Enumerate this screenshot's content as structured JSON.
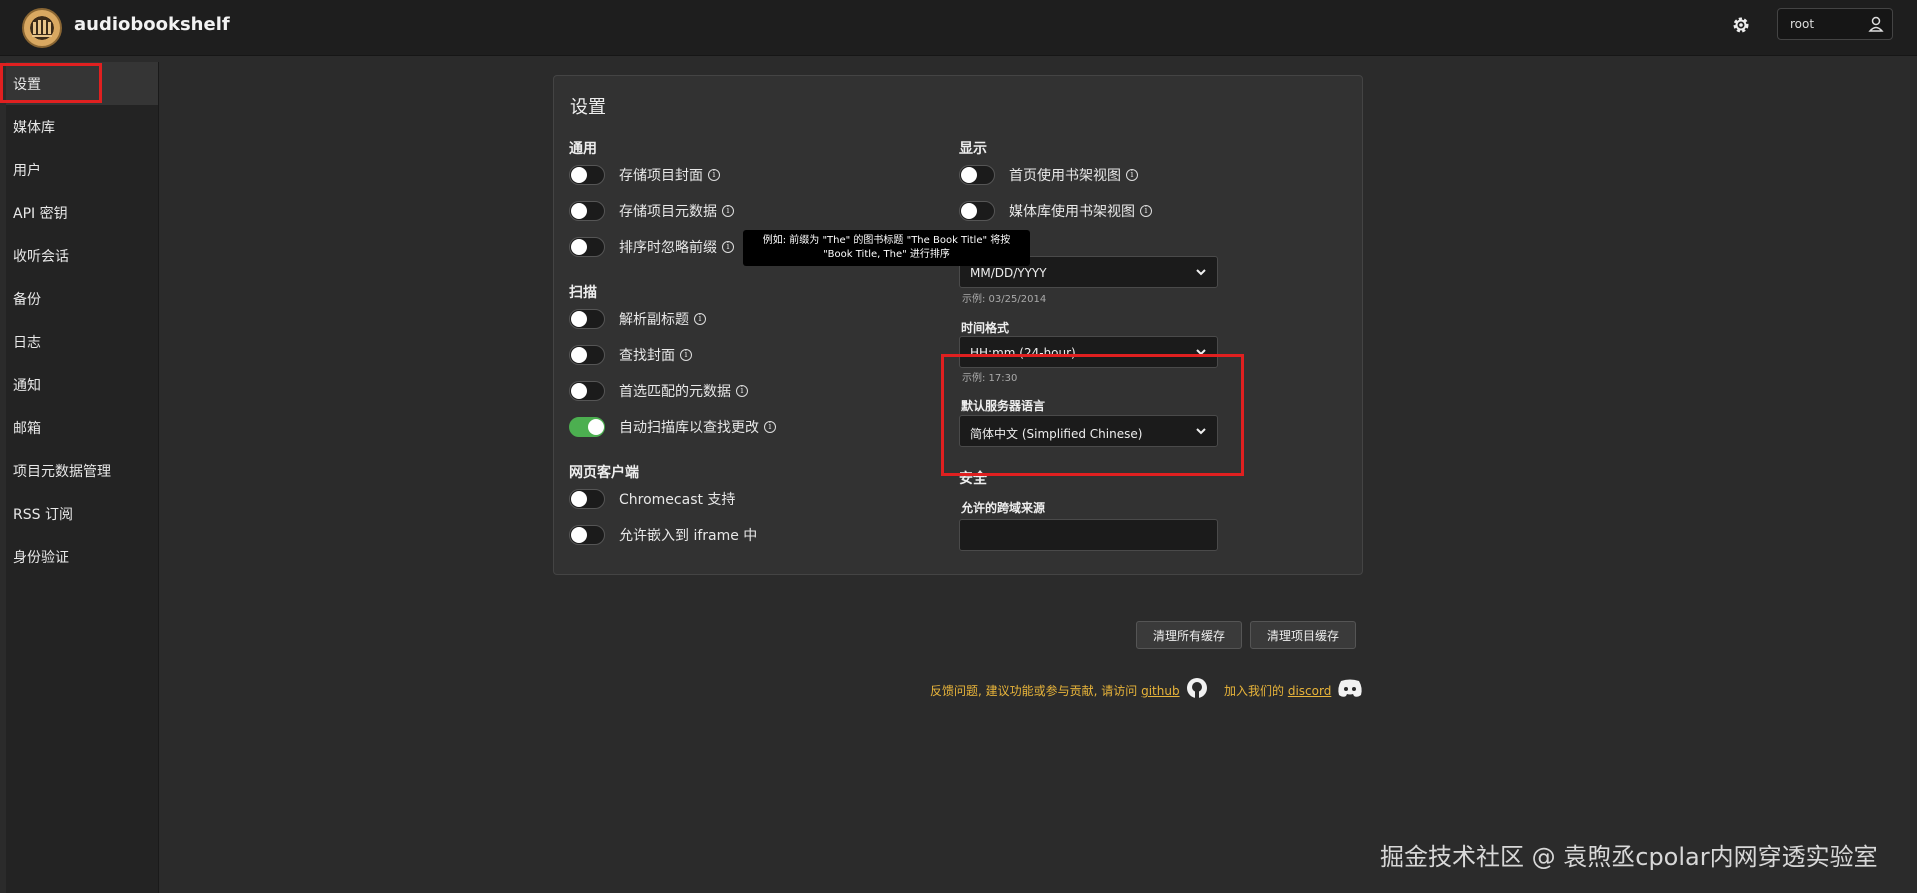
{
  "app": {
    "title": "audiobookshelf"
  },
  "user": {
    "name": "root"
  },
  "sidebar": {
    "items": [
      {
        "label": "设置"
      },
      {
        "label": "媒体库"
      },
      {
        "label": "用户"
      },
      {
        "label": "API 密钥"
      },
      {
        "label": "收听会话"
      },
      {
        "label": "备份"
      },
      {
        "label": "日志"
      },
      {
        "label": "通知"
      },
      {
        "label": "邮箱"
      },
      {
        "label": "项目元数据管理"
      },
      {
        "label": "RSS 订阅"
      },
      {
        "label": "身份验证"
      }
    ]
  },
  "settings": {
    "title": "设置",
    "general": {
      "heading": "通用",
      "items": [
        {
          "label": "存储项目封面",
          "on": false
        },
        {
          "label": "存储项目元数据",
          "on": false
        },
        {
          "label": "排序时忽略前缀",
          "on": false
        }
      ]
    },
    "tooltip": "例如: 前缀为 \"The\" 的图书标题 \"The Book Title\" 将按 \"Book Title, The\" 进行排序",
    "scan": {
      "heading": "扫描",
      "items": [
        {
          "label": "解析副标题",
          "on": false
        },
        {
          "label": "查找封面",
          "on": false
        },
        {
          "label": "首选匹配的元数据",
          "on": false
        },
        {
          "label": "自动扫描库以查找更改",
          "on": true
        }
      ]
    },
    "web_client": {
      "heading": "网页客户端",
      "items": [
        {
          "label": "Chromecast 支持",
          "on": false
        },
        {
          "label": "允许嵌入到 iframe 中",
          "on": false
        }
      ]
    },
    "display": {
      "heading": "显示",
      "items": [
        {
          "label": "首页使用书架视图",
          "on": false
        },
        {
          "label": "媒体库使用书架视图",
          "on": false
        }
      ],
      "date_format": {
        "value": "MM/DD/YYYY",
        "example": "示例: 03/25/2014"
      },
      "time_format": {
        "label": "时间格式",
        "value": "HH:mm (24-hour)",
        "example": "示例: 17:30"
      },
      "language": {
        "label": "默认服务器语言",
        "value": "简体中文 (Simplified Chinese)"
      }
    },
    "security": {
      "heading": "安全",
      "cors_label": "允许的跨域来源",
      "cors_value": ""
    }
  },
  "actions": {
    "purge_all_cache": "清理所有缓存",
    "purge_items_cache": "清理项目缓存"
  },
  "footer": {
    "feedback_text": "反馈问题, 建议功能或参与贡献, 请访问",
    "github_link": "github",
    "discord_text": "加入我们的",
    "discord_link": "discord"
  },
  "watermark": "掘金技术社区 @ 袁煦丞cpolar内网穿透实验室",
  "colors": {
    "accent_toggle_on": "#4caf50",
    "highlight_box": "#e02020",
    "footer_link": "#e8b43a"
  },
  "icons": [
    "app-logo-icon",
    "gear-icon",
    "user-icon",
    "info-icon",
    "chevron-down-icon",
    "github-icon",
    "discord-icon"
  ]
}
